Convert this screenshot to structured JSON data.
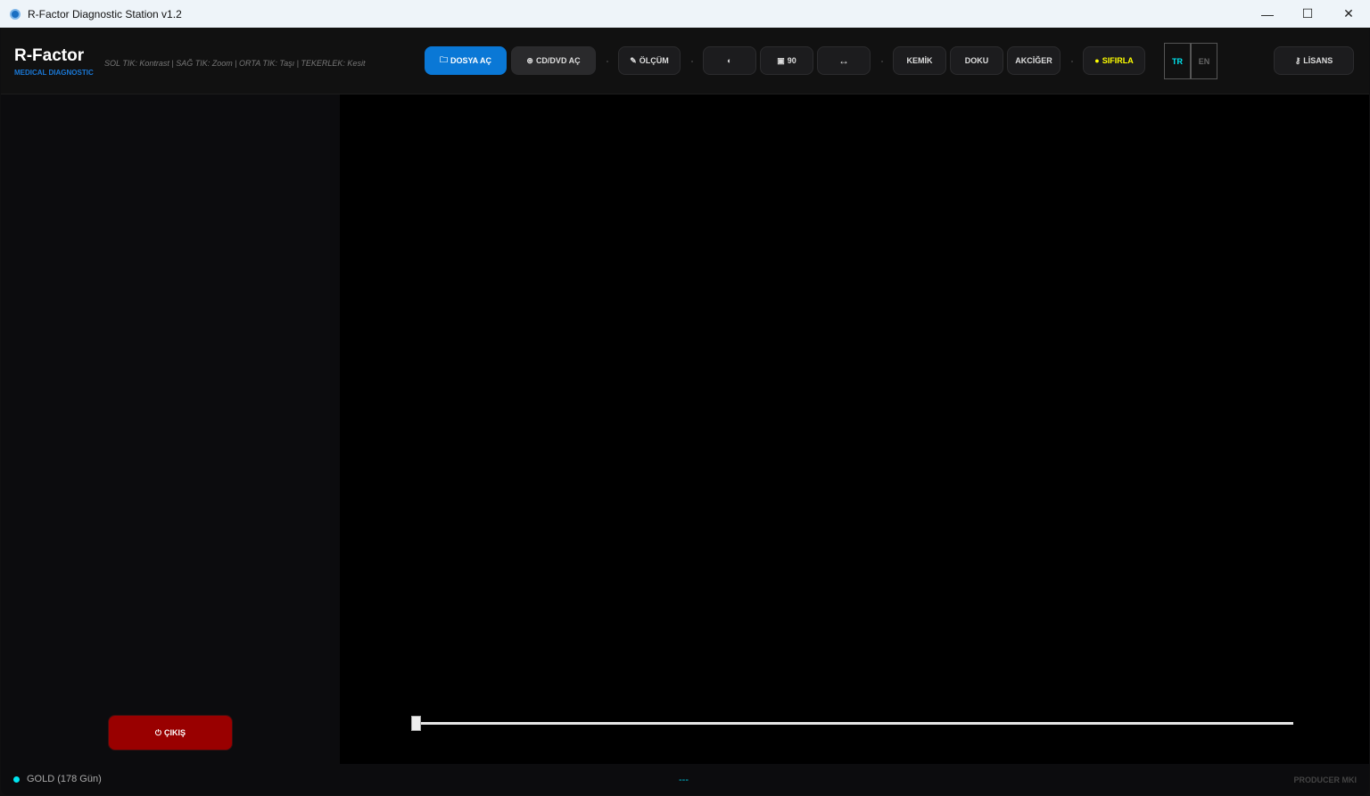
{
  "window": {
    "title": "R-Factor Diagnostic Station v1.2",
    "minimize": "—",
    "maximize": "☐",
    "close": "✕"
  },
  "header": {
    "brand": "R-Factor",
    "brand_sub": "MEDICAL DIAGNOSTIC",
    "hint": "SOL TIK: Kontrast | SAĞ TIK: Zoom | ORTA TIK: Taşı | TEKERLEK: Kesit",
    "open_file": "DOSYA AÇ",
    "open_cd": "CD/DVD AÇ",
    "measure": "ÖLÇÜM",
    "invert": "◐",
    "rotate": "90",
    "flip": "↔",
    "bone": "KEMİK",
    "tissue": "DOKU",
    "lung": "AKCİĞER",
    "reset": "SIFIRLA",
    "lang_tr": "TR",
    "lang_en": "EN",
    "license": "LİSANS"
  },
  "icons": {
    "folder": "🗀",
    "disc": "⊛",
    "ruler": "✎",
    "rotate": "▣",
    "reset": "●",
    "key": "⚷",
    "power": "⏻"
  },
  "colors": {
    "accent": "#0a78d6",
    "exit": "#990000",
    "active_lang": "#00e5f0",
    "reset": "#ffff00"
  },
  "sidebar": {
    "exit": "ÇIKIŞ"
  },
  "viewer": {
    "slice_slider_value": 0
  },
  "status": {
    "license": "GOLD (178 Gün)",
    "center": "---",
    "right": "PRODUCER MKI"
  }
}
